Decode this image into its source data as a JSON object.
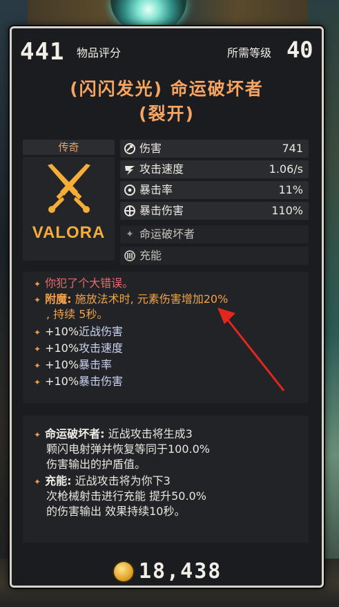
{
  "item": {
    "score": "441",
    "score_label": "物品评分",
    "level_label": "所需等级",
    "level": "40",
    "title_line1": "(闪闪发光) 命运破坏者",
    "title_line2": "(裂开)",
    "rarity": "传奇",
    "manufacturer": "VALORA"
  },
  "stats": [
    {
      "label": "伤害",
      "value": "741",
      "icon": "damage-icon"
    },
    {
      "label": "攻击速度",
      "value": "1.06/s",
      "icon": "attack-speed-icon"
    },
    {
      "label": "暴击率",
      "value": "11%",
      "icon": "crit-chance-icon"
    },
    {
      "label": "暴击伤害",
      "value": "110%",
      "icon": "crit-damage-icon"
    },
    {
      "label": "命运破坏者",
      "value": "",
      "icon": "star-icon"
    },
    {
      "label": "充能",
      "value": "",
      "icon": "charge-icon"
    }
  ],
  "effects": {
    "flavor": "你犯了个大错误。",
    "enchant_key": "附魔:",
    "enchant_text": "施放法术时, 元素伤害增加20%",
    "enchant_text2": ", 持续 5秒。",
    "bonuses": [
      {
        "value": "+10%",
        "label": "近战伤害"
      },
      {
        "value": "+10%",
        "label": "攻击速度"
      },
      {
        "value": "+10%",
        "label": "暴击率"
      },
      {
        "value": "+10%",
        "label": "暴击伤害"
      }
    ]
  },
  "descriptions": {
    "fate_key": "命运破坏者:",
    "fate_l1": "近战攻击将生成3",
    "fate_l2": "颗闪电射弹并恢复等同于100.0%",
    "fate_l3": "伤害输出的护盾值。",
    "charge_key": "充能:",
    "charge_l1": "近战攻击将为你下3",
    "charge_l2": "次枪械射击进行充能 提升50.0%",
    "charge_l3": "的伤害输出 效果持续10秒。"
  },
  "price": "18,438",
  "colors": {
    "title": "#f6a462",
    "rarity": "#f0a25c",
    "flavor": "#ea6a6a",
    "enchant": "#f1a24b",
    "manufacturer": "#f4ad36",
    "annotation_arrow": "#e3271e"
  }
}
